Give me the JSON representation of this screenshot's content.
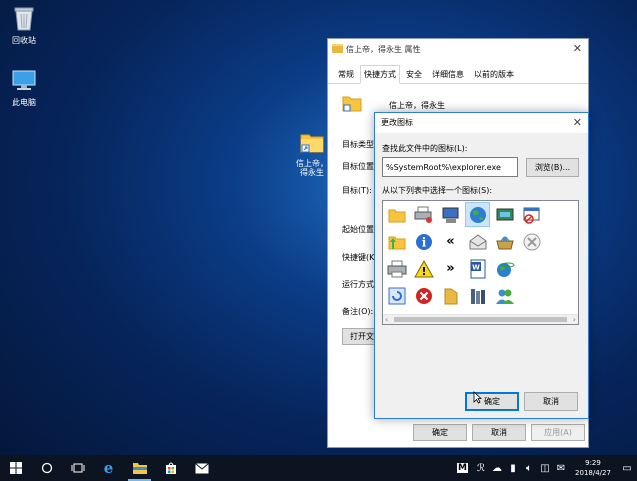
{
  "desktop": {
    "icons": [
      {
        "label": "回收站",
        "icon": "recycle-bin-icon"
      },
      {
        "label": "此电脑",
        "icon": "this-pc-icon"
      },
      {
        "label": "信上帝，\n得永生",
        "icon": "folder-shortcut-icon"
      }
    ]
  },
  "properties": {
    "title": "信上帝，得永生 属性",
    "tabs": [
      "常规",
      "快捷方式",
      "安全",
      "详细信息",
      "以前的版本"
    ],
    "active_tab": "快捷方式",
    "name": "信上帝，得永生",
    "rows": [
      "目标类型:",
      "目标位置:",
      "目标(T):",
      "起始位置(",
      "快捷键(K):",
      "运行方式(",
      "备注(O):"
    ],
    "open_btn": "打开文",
    "ok": "确定",
    "cancel": "取消",
    "apply": "应用(A)"
  },
  "dialog": {
    "title": "更改图标",
    "find_label": "查找此文件中的图标(L):",
    "path_value": "%SystemRoot%\\explorer.exe",
    "browse": "浏览(B)...",
    "select_label": "从以下列表中选择一个图标(S):",
    "icons": [
      [
        "folder-icon",
        "printer-network-icon",
        "monitor-icon",
        "globe-icon",
        "network-monitor-icon",
        "blocked-window-icon"
      ],
      [
        "folder-up-icon",
        "info-icon",
        "double-left-arrow-icon",
        "mail-open-icon",
        "basket-icon",
        "cancel-x-icon"
      ],
      [
        "printer-icon",
        "warning-icon",
        "double-right-arrow-icon",
        "word-document-icon",
        "internet-icon"
      ],
      [
        "refresh-icon",
        "error-icon",
        "folder-icon",
        "library-icon",
        "users-icon"
      ]
    ],
    "selected_icon": "globe-icon",
    "ok": "确定",
    "cancel": "取消"
  },
  "taskbar": {
    "time": "9:29",
    "date": "2018/4/27",
    "accent": "#76b9ed",
    "tray": [
      "M",
      "user-icon",
      "cloud-icon",
      "battery-icon",
      "volume-icon",
      "network-icon",
      "chat-icon",
      "notification-icon"
    ]
  }
}
